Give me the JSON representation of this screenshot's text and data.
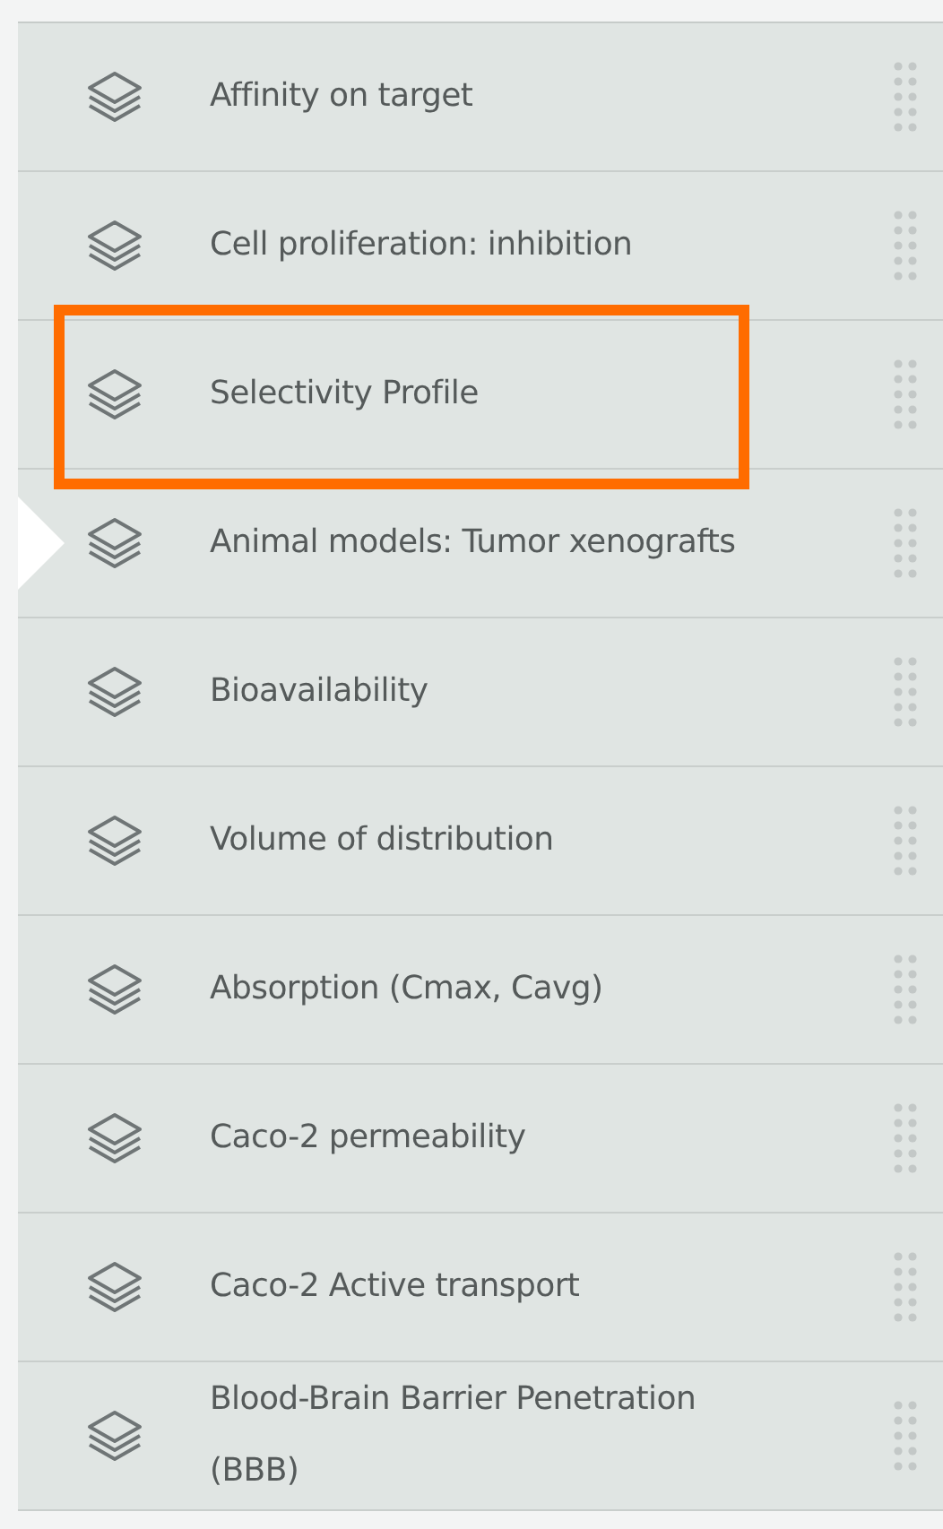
{
  "items": [
    {
      "label": "Affinity on target",
      "highlighted": false,
      "current": false
    },
    {
      "label": "Cell proliferation: inhibition",
      "highlighted": false,
      "current": false
    },
    {
      "label": "Selectivity Profile",
      "highlighted": true,
      "current": false
    },
    {
      "label": "Animal models: Tumor xenografts",
      "highlighted": false,
      "current": true
    },
    {
      "label": "Bioavailability",
      "highlighted": false,
      "current": false
    },
    {
      "label": "Volume of distribution",
      "highlighted": false,
      "current": false
    },
    {
      "label": "Absorption (Cmax, Cavg)",
      "highlighted": false,
      "current": false
    },
    {
      "label": "Caco-2 permeability",
      "highlighted": false,
      "current": false
    },
    {
      "label": "Caco-2 Active transport",
      "highlighted": false,
      "current": false
    },
    {
      "label": "Blood-Brain Barrier Penetration (BBB)",
      "highlighted": false,
      "current": false
    }
  ]
}
